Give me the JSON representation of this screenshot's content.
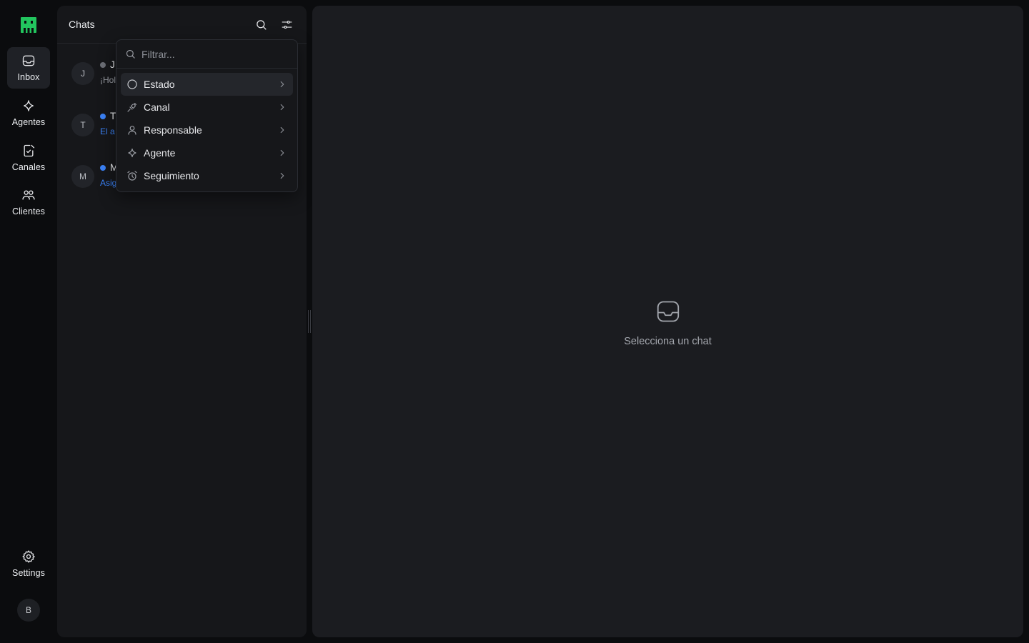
{
  "colors": {
    "brand": "#22c55e",
    "unread_dot": "#3b82f6",
    "read_dot": "#6b6e75"
  },
  "rail": {
    "items": [
      {
        "label": "Inbox",
        "icon": "inbox-icon",
        "active": true
      },
      {
        "label": "Agentes",
        "icon": "sparkle-icon"
      },
      {
        "label": "Canales",
        "icon": "channels-icon"
      },
      {
        "label": "Clientes",
        "icon": "users-icon"
      }
    ],
    "settings": {
      "label": "Settings",
      "icon": "gear-icon"
    },
    "user_initial": "B"
  },
  "chats": {
    "title": "Chats",
    "list": [
      {
        "initial": "J",
        "name": "J",
        "preview": "¡Hol",
        "unread": false
      },
      {
        "initial": "T",
        "name": "T",
        "preview": "El a",
        "unread": true
      },
      {
        "initial": "M",
        "name": "M",
        "preview": "Asig",
        "unread": true
      }
    ]
  },
  "filter_menu": {
    "placeholder": "Filtrar...",
    "items": [
      {
        "label": "Estado",
        "icon": "circle-icon",
        "active": true
      },
      {
        "label": "Canal",
        "icon": "plug-icon"
      },
      {
        "label": "Responsable",
        "icon": "user-icon"
      },
      {
        "label": "Agente",
        "icon": "sparkle-icon"
      },
      {
        "label": "Seguimiento",
        "icon": "alarm-icon"
      }
    ]
  },
  "main": {
    "empty_text": "Selecciona un chat",
    "empty_icon": "inbox-icon"
  }
}
